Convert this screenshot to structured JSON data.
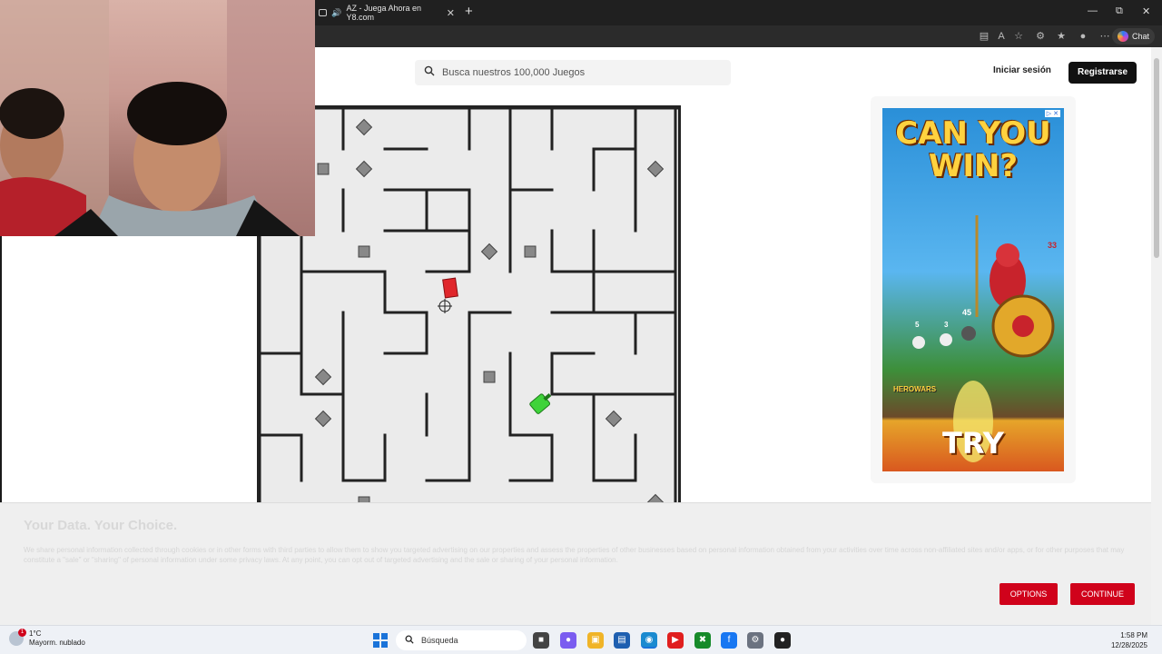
{
  "browser": {
    "tab_title": "AZ - Juega Ahora en Y8.com",
    "tab_close": "✕",
    "new_tab": "+",
    "chat_label": "Chat"
  },
  "header": {
    "search_placeholder": "Busca nuestros 100,000 Juegos",
    "login_label": "Iniciar sesión",
    "register_label": "Registrarse"
  },
  "ad": {
    "headline": "CAN YOU WIN?",
    "cta": "TRY",
    "brand": "HEROWARS",
    "levels": [
      "5",
      "3",
      "45",
      "33"
    ]
  },
  "consent": {
    "title": "Your Data. Your Choice.",
    "body": "We share personal information collected through cookies or in other forms with third parties to allow them to show you targeted advertising on our properties and assess the properties of other businesses based on personal information obtained from your activities over time across non-affiliated sites and/or apps, or for other purposes that may constitute a \"sale\" or \"sharing\" of personal information under some privacy laws. At any point, you can opt out of targeted advertising and the sale or sharing of your personal information.",
    "options_label": "OPTIONS",
    "continue_label": "CONTINUE"
  },
  "taskbar": {
    "weather_temp": "1°C",
    "weather_desc": "Mayorm. nublado",
    "weather_badge": "1",
    "search_label": "Búsqueda",
    "time": "1:58 PM",
    "date": "12/28/2025"
  },
  "colors": {
    "accent_red": "#d0021b",
    "player_red": "#e0262b",
    "player_green": "#3fd33a",
    "wall": "#222222"
  },
  "icons": [
    "search-icon",
    "window-minimize-icon",
    "window-maximize-icon",
    "window-close-icon",
    "crosshair-icon",
    "windows-start-icon"
  ]
}
